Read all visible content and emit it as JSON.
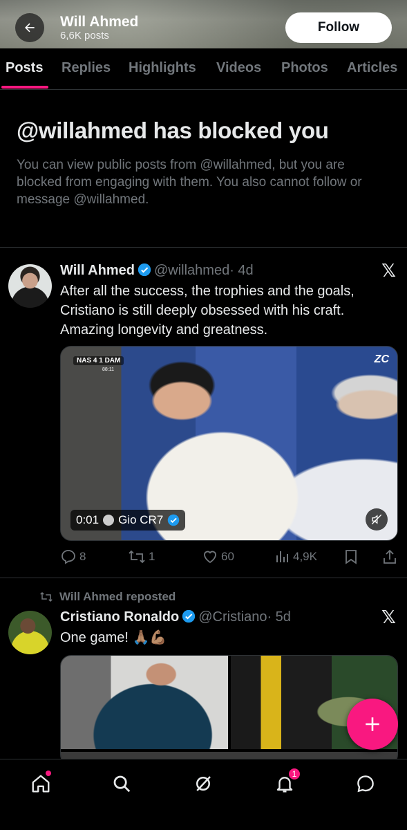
{
  "header": {
    "name": "Will Ahmed",
    "post_count": "6,6K posts",
    "follow_label": "Follow"
  },
  "tabs": [
    {
      "label": "Posts",
      "active": true
    },
    {
      "label": "Replies"
    },
    {
      "label": "Highlights"
    },
    {
      "label": "Videos"
    },
    {
      "label": "Photos"
    },
    {
      "label": "Articles"
    }
  ],
  "blocked": {
    "title": "@willahmed has blocked you",
    "text": "You can view public posts from @willahmed, but you are blocked from engaging with them. You also cannot follow or message @willahmed."
  },
  "tweet1": {
    "name": "Will Ahmed",
    "handle": "@willahmed",
    "time": "· 4d",
    "text": "After all the success, the trophies and the goals, Cristiano is still deeply obsessed with his craft. Amazing longevity and greatness.",
    "video": {
      "scorebug": "NAS 4 1 DAM",
      "match_clock": "88:11",
      "watermark": "ZC",
      "time": "0:01",
      "source": "Gio CR7"
    },
    "stats": {
      "replies": "8",
      "reposts": "1",
      "likes": "60",
      "views": "4,9K"
    }
  },
  "tweet2": {
    "repost_label": "Will Ahmed reposted",
    "name": "Cristiano Ronaldo",
    "handle": "@Cristiano",
    "time": "· 5d",
    "text": "One game! 🙏🏽💪🏽"
  },
  "nav": {
    "notifications_badge": "1"
  },
  "colors": {
    "accent": "#f91880",
    "verified": "#1d9bf0",
    "muted": "#71767b"
  }
}
